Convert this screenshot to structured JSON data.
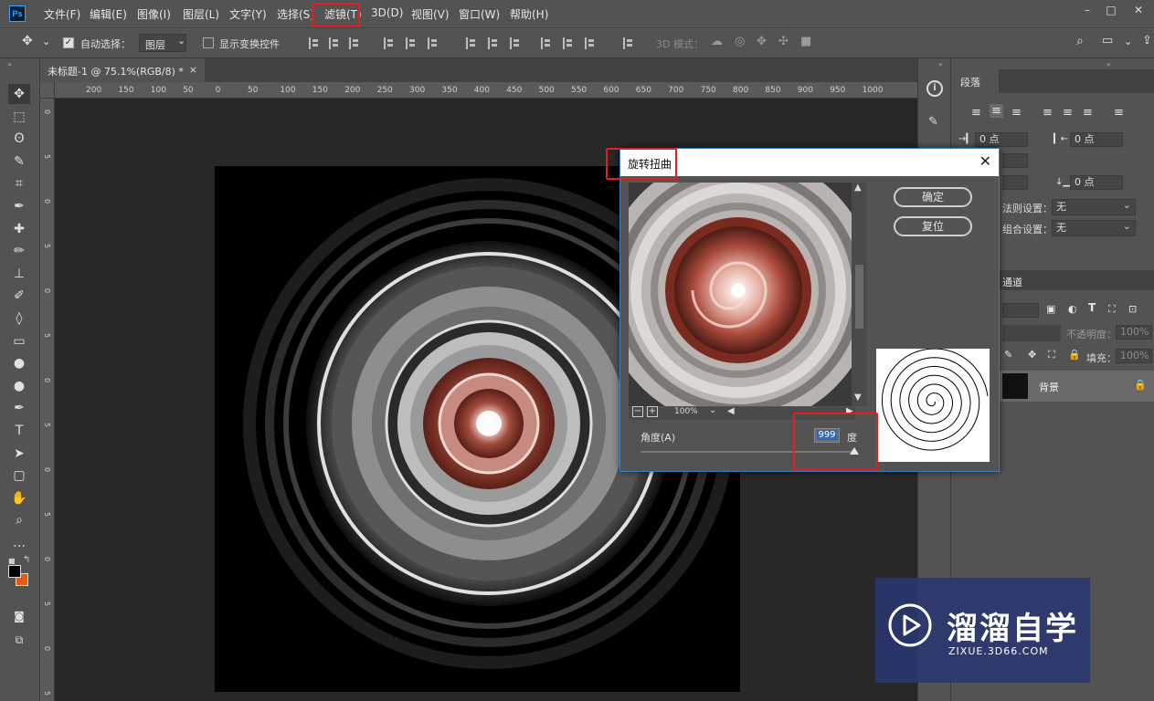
{
  "app": {
    "logo": "Ps"
  },
  "menubar": {
    "items": [
      "文件(F)",
      "编辑(E)",
      "图像(I)",
      "图层(L)",
      "文字(Y)",
      "选择(S)",
      "滤镜(T)",
      "3D(D)",
      "视图(V)",
      "窗口(W)",
      "帮助(H)"
    ],
    "highlighted": "滤镜(T)"
  },
  "options": {
    "auto_select_label": "自动选择：",
    "auto_select_checked": true,
    "auto_select_target": "图层",
    "show_transform_label": "显示变换控件",
    "show_transform_checked": false,
    "mode_3d_label": "3D 模式："
  },
  "document": {
    "tab_title": "未标题-1 @ 75.1%(RGB/8) *",
    "ruler_ticks": [
      "200",
      "150",
      "100",
      "50",
      "0",
      "50",
      "100",
      "150",
      "200",
      "250",
      "300",
      "350",
      "400",
      "450",
      "500",
      "550",
      "600",
      "650",
      "700",
      "750",
      "800",
      "850",
      "900",
      "950",
      "1000"
    ],
    "ruler_left_ticks": [
      "0",
      "5",
      "0",
      "5",
      "0",
      "5",
      "0",
      "5",
      "0",
      "5",
      "0",
      "5",
      "0",
      "5"
    ]
  },
  "tools": [
    "move-tool",
    "marquee-tool",
    "lasso-tool",
    "quick-select-tool",
    "crop-tool",
    "eyedropper-tool",
    "healing-tool",
    "brush-tool",
    "stamp-tool",
    "history-brush-tool",
    "eraser-tool",
    "gradient-tool",
    "blur-tool",
    "dodge-tool",
    "pen-tool",
    "type-tool",
    "path-select-tool",
    "shape-tool",
    "hand-tool",
    "zoom-tool",
    "more-tool"
  ],
  "tool_glyphs": [
    "✥",
    "⬚",
    "ʘ",
    "✎",
    "⌗",
    "✒",
    "✚",
    "✏",
    "⊥",
    "✐",
    "◊",
    "▭",
    "●",
    "●",
    "✒",
    "T",
    "➤",
    "▢",
    "✋",
    "⌕",
    "…"
  ],
  "paragraph_panel": {
    "tab": "段落",
    "indent_left_value": "0 点",
    "indent_right_value": "0 点",
    "space_after_value": "0 点",
    "hyphen_label": "法则设置：",
    "hyphen_value": "无",
    "compose_label": "组合设置：",
    "compose_value": "无"
  },
  "layers_panel": {
    "tab": "通道",
    "opacity_label": "不透明度：",
    "opacity_value": "100%",
    "fill_label": "填充：",
    "fill_value": "100%",
    "layer_name": "背景"
  },
  "dialog": {
    "title": "旋转扭曲",
    "ok_label": "确定",
    "reset_label": "复位",
    "zoom_value": "100%",
    "angle_label": "角度(A)",
    "angle_value": "999",
    "angle_unit": "度",
    "zoom_out_symbol": "−",
    "zoom_in_symbol": "+"
  },
  "watermark": {
    "title": "溜溜自学",
    "url": "ZIXUE.3D66.COM"
  },
  "colors": {
    "highlight": "#e02020",
    "foreground": "#000000",
    "background": "#e85a10"
  }
}
